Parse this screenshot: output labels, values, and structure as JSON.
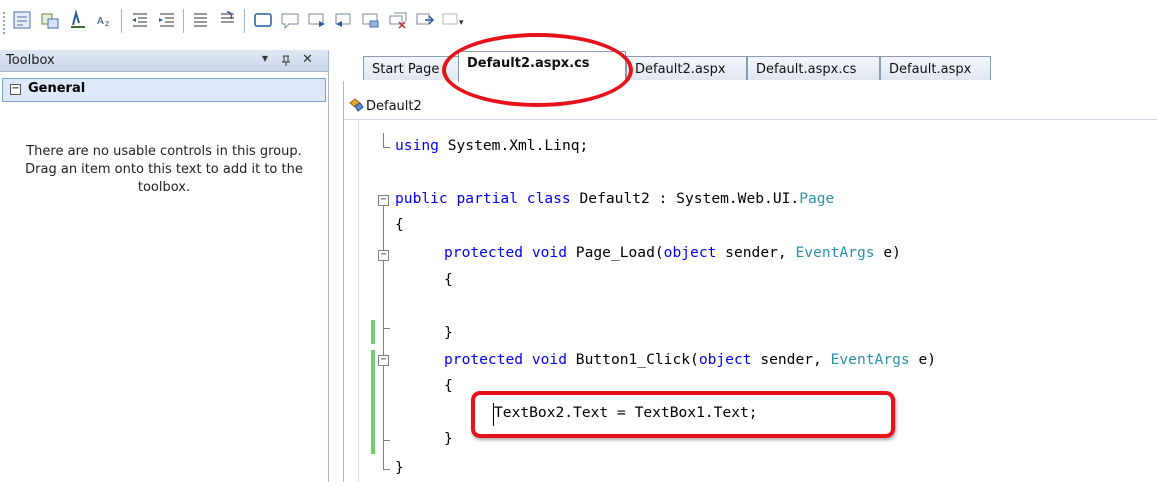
{
  "toolbar": {
    "icons": [
      "grip-icon",
      "properties-icon",
      "wizard-icon",
      "draw-icon",
      "sort-icon",
      "outdent-icon",
      "indent-icon",
      "comment-icon",
      "uncomment-icon",
      "rectangle-icon",
      "bookmark-icon",
      "next-bookmark-icon",
      "prev-bookmark-icon",
      "folder-bookmark-icon",
      "clear-bookmarks-icon",
      "export-icon",
      "more-icon"
    ],
    "overflow": "▾"
  },
  "toolbox": {
    "title": "Toolbox",
    "pin": "ᵖ",
    "dropdown": "▾",
    "close": "✕",
    "group_expander": "−",
    "group_label": "General",
    "empty_message": "There are no usable controls in this group. Drag an item onto this text to add it to the toolbox."
  },
  "tabs": [
    {
      "label": "Start Page",
      "active": false
    },
    {
      "label": "Default2.aspx.cs",
      "active": true
    },
    {
      "label": "Default2.aspx",
      "active": false
    },
    {
      "label": "Default.aspx.cs",
      "active": false
    },
    {
      "label": "Default.aspx",
      "active": false
    }
  ],
  "editor": {
    "class_dropdown": "Default2",
    "lines": {
      "using_kw": "using",
      "using_rest": " System.Xml.Linq;",
      "class_kw": "public partial class",
      "class_name": " Default2 : System.Web.UI.",
      "class_base": "Page",
      "brace_open": "{",
      "pl_kw": "protected void",
      "pl_name": " Page_Load(",
      "pl_obj": "object",
      "pl_sender": " sender, ",
      "pl_args": "EventArgs",
      "pl_e": " e)",
      "pl_open": "{",
      "pl_close": "}",
      "bc_kw": "protected void",
      "bc_name": " Button1_Click(",
      "bc_obj": "object",
      "bc_sender": " sender, ",
      "bc_args": "EventArgs",
      "bc_e": " e)",
      "bc_open": "{",
      "bc_stmt": "TextBox2.Text = TextBox1.Text;",
      "bc_close": "}",
      "brace_close": "}"
    }
  },
  "colors": {
    "keyword": "#0000ff",
    "type": "#2b91af",
    "highlight": "#e8121a",
    "changed_margin": "#6ccf6c"
  }
}
